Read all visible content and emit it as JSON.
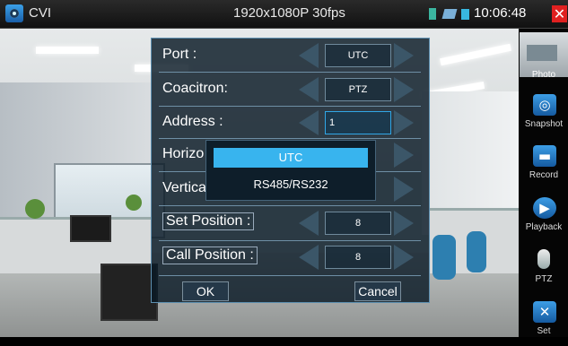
{
  "status_bar": {
    "app_title": "CVI",
    "resolution": "1920x1080P 30fps",
    "time": "10:06:48",
    "close_label": "✕"
  },
  "dialog": {
    "rows": [
      {
        "label": "Port :",
        "value": "UTC"
      },
      {
        "label": "Coacitron:",
        "value": "PTZ"
      },
      {
        "label": "Address :",
        "value": "1"
      },
      {
        "label": "Horizo",
        "value": ""
      },
      {
        "label": "Vertica",
        "value": ""
      },
      {
        "label": "Set Position :",
        "value": "8"
      },
      {
        "label": "Call Position :",
        "value": "8"
      }
    ],
    "ok_label": "OK",
    "cancel_label": "Cancel"
  },
  "dropdown": {
    "options": [
      "UTC",
      "RS485/RS232"
    ],
    "selected": "UTC"
  },
  "sidebar": {
    "items": [
      {
        "label": "Photo",
        "icon": "photo-thumbnail"
      },
      {
        "label": "Snapshot",
        "icon": "camera-icon"
      },
      {
        "label": "Record",
        "icon": "record-icon"
      },
      {
        "label": "Playback",
        "icon": "play-icon"
      },
      {
        "label": "PTZ",
        "icon": "ptz-camera-icon"
      },
      {
        "label": "Set",
        "icon": "tools-icon"
      }
    ]
  },
  "colors": {
    "accent": "#38b4ee",
    "close": "#e02020",
    "panel": "#081824"
  }
}
